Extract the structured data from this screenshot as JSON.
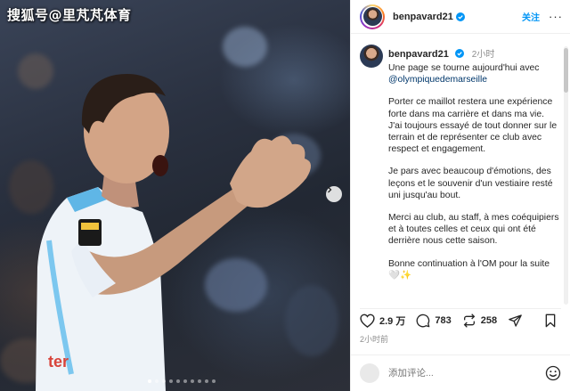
{
  "watermark": "搜狐号@里芃芃体育",
  "post": {
    "username": "benpavard21",
    "follow_label": "关注",
    "more_label": "···",
    "caption_time": "2小时",
    "caption": {
      "p1_line": "Une page se tourne aujourd'hui avec",
      "mention": "@olympiquedemarseille",
      "p2": "Porter ce maillot restera une expérience forte dans ma carrière et dans ma vie. J'ai toujours essayé de tout donner sur le terrain et de représenter ce club avec respect et engagement.",
      "p3": "Je pars avec beaucoup d'émotions, des leçons et le souvenir d'un vestiaire resté uni jusqu'au bout.",
      "p4": "Merci au club, au staff, à mes coéquipiers et à toutes celles et ceux qui ont été derrière nous cette saison.",
      "p5": "Bonne continuation à l'OM pour la suite 🤍✨"
    },
    "likes": "2.9 万",
    "comments": "783",
    "shares": "258",
    "post_time": "2小时前",
    "comment_placeholder": "添加评论..."
  },
  "icons": {
    "verified": "verified-badge-icon",
    "like": "heart-icon",
    "comment": "comment-bubble-icon",
    "share": "repost-icon",
    "send": "paper-plane-icon",
    "save": "bookmark-icon",
    "emoji": "smiley-icon",
    "next": "chevron-right-icon"
  },
  "colors": {
    "accent": "#0095f6",
    "mention": "#00376b",
    "muted": "#8e8e8e",
    "verified": "#0095f6"
  },
  "carousel": {
    "current": 1,
    "total": 10
  }
}
